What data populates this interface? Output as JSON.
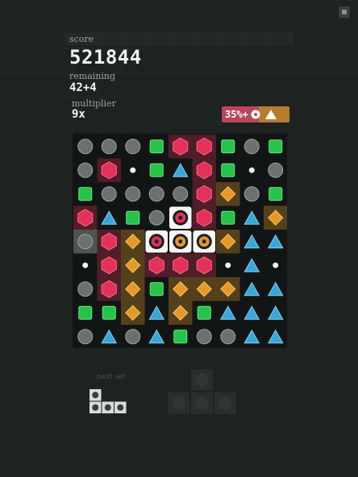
{
  "hud": {
    "score_label": "score",
    "score": "521844",
    "remaining_label": "remaining",
    "remaining": "42+4",
    "multiplier_label": "multiplier",
    "multiplier": "9x",
    "bonus_text": "35%+",
    "bonus_icons": [
      "circle-dot-icon",
      "triangle-icon"
    ]
  },
  "next_label": "next set",
  "colors": {
    "red": "#e2325a",
    "orange": "#e39a2a",
    "green": "#27c24a",
    "blue": "#3aa6d6",
    "gray": "#6c7170",
    "dot": "#f2f2f2",
    "board_bg": "#121515"
  },
  "legend": {
    "H": "red-hexagon",
    "D": "orange-diamond",
    "S": "green-square",
    "T": "blue-triangle",
    "C": "gray-circle",
    "O": "white-dot",
    "R": "red-target",
    "Y": "orange-target"
  },
  "board": {
    "rows": [
      [
        "C",
        "C",
        "C",
        "S",
        "H",
        "H",
        "S",
        "C",
        "S"
      ],
      [
        "C",
        "H",
        "O",
        "S",
        "T",
        "H",
        "S",
        "O",
        "C"
      ],
      [
        "S",
        "C",
        "C",
        "C",
        "C",
        "H",
        "D",
        "C",
        "S"
      ],
      [
        "H",
        "T",
        "S",
        "C",
        "R",
        "H",
        "S",
        "T",
        "D"
      ],
      [
        "C",
        "H",
        "D",
        "R",
        "Y",
        "Y",
        "D",
        "T",
        "T"
      ],
      [
        "O",
        "H",
        "D",
        "H",
        "H",
        "H",
        "O",
        "T",
        "O"
      ],
      [
        "C",
        "H",
        "D",
        "S",
        "D",
        "D",
        "D",
        "T",
        "T"
      ],
      [
        "S",
        "S",
        "D",
        "T",
        "D",
        "S",
        "T",
        "T",
        "T"
      ],
      [
        "C",
        "T",
        "C",
        "T",
        "S",
        "C",
        "C",
        "T",
        "T"
      ]
    ],
    "highlighted": [
      [
        0,
        4
      ],
      [
        0,
        5
      ],
      [
        1,
        1
      ],
      [
        1,
        5
      ],
      [
        2,
        5
      ],
      [
        3,
        0
      ],
      [
        3,
        5
      ],
      [
        4,
        1
      ],
      [
        5,
        1
      ],
      [
        6,
        1
      ],
      [
        5,
        3
      ],
      [
        5,
        4
      ],
      [
        5,
        5
      ],
      [
        2,
        6
      ],
      [
        3,
        8
      ],
      [
        4,
        2
      ],
      [
        5,
        2
      ],
      [
        6,
        2
      ],
      [
        7,
        2
      ],
      [
        4,
        6
      ],
      [
        6,
        4
      ],
      [
        6,
        5
      ],
      [
        6,
        6
      ],
      [
        7,
        4
      ]
    ],
    "selected": [
      [
        3,
        4
      ],
      [
        4,
        3
      ],
      [
        4,
        4
      ],
      [
        4,
        5
      ]
    ],
    "hover": [
      [
        4,
        0
      ]
    ]
  },
  "next_set": {
    "cells": [
      [
        0,
        0
      ],
      [
        1,
        0
      ],
      [
        1,
        1
      ],
      [
        1,
        2
      ]
    ]
  },
  "ghost_preview": {
    "cells": [
      [
        0,
        1
      ],
      [
        1,
        0
      ],
      [
        1,
        1
      ],
      [
        1,
        2
      ]
    ]
  }
}
